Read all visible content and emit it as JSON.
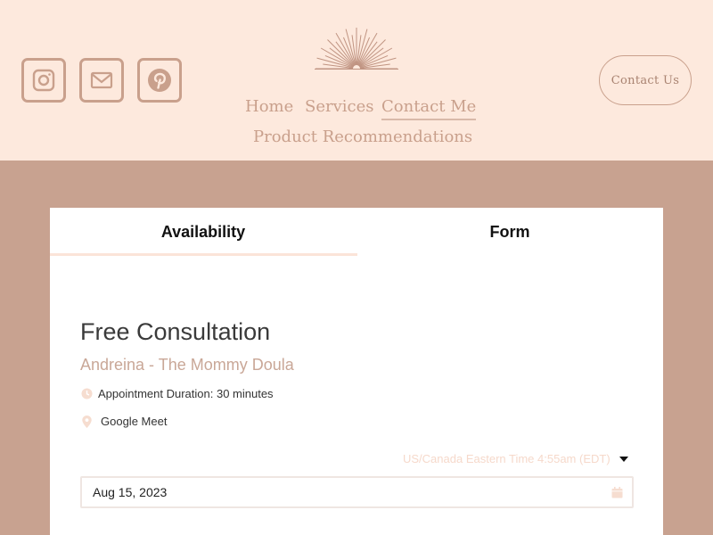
{
  "header": {
    "social": [
      {
        "name": "instagram-icon"
      },
      {
        "name": "mail-icon"
      },
      {
        "name": "pinterest-icon"
      }
    ],
    "nav": {
      "home": "Home",
      "services": "Services",
      "contact_me": "Contact Me",
      "product_recommendations": "Product Recommendations"
    },
    "contact_button": "Contact Us"
  },
  "scheduler": {
    "tabs": {
      "availability": "Availability",
      "form": "Form"
    },
    "title": "Free Consultation",
    "provider": "Andreina - The Mommy Doula",
    "duration": "Appointment Duration: 30 minutes",
    "location": "Google Meet",
    "timezone": "US/Canada Eastern Time 4:55am (EDT)",
    "date_value": "Aug 15, 2023"
  },
  "colors": {
    "header_bg": "#fde9dd",
    "page_bg": "#c8a290",
    "accent": "#c9a08c"
  }
}
